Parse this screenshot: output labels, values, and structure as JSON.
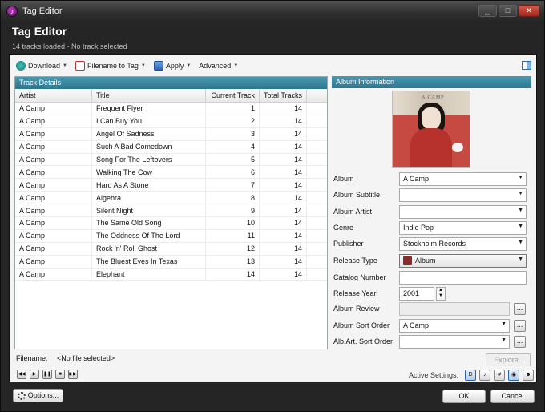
{
  "window": {
    "title": "Tag Editor",
    "controls": {
      "minimize": "▁",
      "maximize": "□",
      "close": "✕"
    }
  },
  "header": {
    "title": "Tag Editor",
    "subtitle": "14 tracks loaded - No track selected"
  },
  "toolbar": {
    "download": "Download",
    "filename_to_tag": "Filename to Tag",
    "apply": "Apply",
    "advanced": "Advanced"
  },
  "track_details": {
    "heading": "Track Details",
    "columns": [
      "Artist",
      "Title",
      "Current Track",
      "Total Tracks"
    ],
    "rows": [
      [
        "A Camp",
        "Frequent Flyer",
        "1",
        "14"
      ],
      [
        "A Camp",
        "I Can Buy You",
        "2",
        "14"
      ],
      [
        "A Camp",
        "Angel Of Sadness",
        "3",
        "14"
      ],
      [
        "A Camp",
        "Such A Bad Comedown",
        "4",
        "14"
      ],
      [
        "A Camp",
        "Song For The Leftovers",
        "5",
        "14"
      ],
      [
        "A Camp",
        "Walking The Cow",
        "6",
        "14"
      ],
      [
        "A Camp",
        "Hard As A Stone",
        "7",
        "14"
      ],
      [
        "A Camp",
        "Algebra",
        "8",
        "14"
      ],
      [
        "A Camp",
        "Silent Night",
        "9",
        "14"
      ],
      [
        "A Camp",
        "The Same Old Song",
        "10",
        "14"
      ],
      [
        "A Camp",
        "The Oddness Of The Lord",
        "11",
        "14"
      ],
      [
        "A Camp",
        "Rock 'n' Roll Ghost",
        "12",
        "14"
      ],
      [
        "A Camp",
        "The Bluest Eyes In Texas",
        "13",
        "14"
      ],
      [
        "A Camp",
        "Elephant",
        "14",
        "14"
      ]
    ]
  },
  "album_info": {
    "heading": "Album Information",
    "cover_text": "A CAMP",
    "labels": {
      "album": "Album",
      "album_subtitle": "Album Subtitle",
      "album_artist": "Album Artist",
      "genre": "Genre",
      "publisher": "Publisher",
      "release_type": "Release Type",
      "catalog_number": "Catalog Number",
      "release_year": "Release Year",
      "album_review": "Album Review",
      "album_sort_order": "Album Sort Order",
      "alb_art_sort_order": "Alb.Art. Sort Order"
    },
    "values": {
      "album": "A Camp",
      "album_subtitle": "",
      "album_artist": "",
      "genre": "Indie Pop",
      "publisher": "Stockholm Records",
      "release_type": "Album",
      "catalog_number": "",
      "release_year": "2001",
      "album_review": "",
      "album_sort_order": "A Camp",
      "alb_art_sort_order": ""
    },
    "ellipsis": "..."
  },
  "filename": {
    "label": "Filename:",
    "value": "<No file selected>"
  },
  "explore_button": "Explore..",
  "active_settings_label": "Active Settings:",
  "buttons": {
    "options": "Options...",
    "ok": "OK",
    "cancel": "Cancel"
  }
}
